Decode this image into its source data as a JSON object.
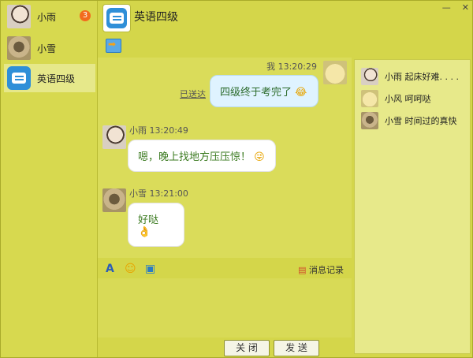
{
  "contacts": [
    {
      "name": "小雨",
      "badge": "3",
      "avatar": "boy-avatar"
    },
    {
      "name": "小雪",
      "avatar": "girl-avatar"
    },
    {
      "name": "英语四级",
      "avatar": "chat-group-icon",
      "active": true
    }
  ],
  "header": {
    "title": "英语四级"
  },
  "chat": {
    "messages": [
      {
        "sender": "我",
        "time": "13:20:29",
        "text": "四级终于考完了",
        "emoji": "laugh-emoji",
        "status": "已送达"
      },
      {
        "sender": "小雨",
        "time": "13:20:49",
        "text": "嗯，晚上找地方压压惊！",
        "emoji": "wink-emoji"
      },
      {
        "sender": "小雪",
        "time": "13:21:00",
        "text": "好哒",
        "emoji": "ok-hand-emoji"
      }
    ]
  },
  "toolbar": {
    "history_label": "消息记录"
  },
  "buttons": {
    "close": "关 闭",
    "send": "发 送"
  },
  "right_panel": [
    {
      "name": "小雨",
      "text": "起床好难. . . ."
    },
    {
      "name": "小风",
      "text": "呵呵哒"
    },
    {
      "name": "小雪",
      "text": "时间过的真快"
    }
  ],
  "colors": {
    "background": "#d4d64a",
    "my_bubble": "#dff3ff",
    "other_bubble": "#ffffff",
    "badge": "#f26b1d"
  }
}
